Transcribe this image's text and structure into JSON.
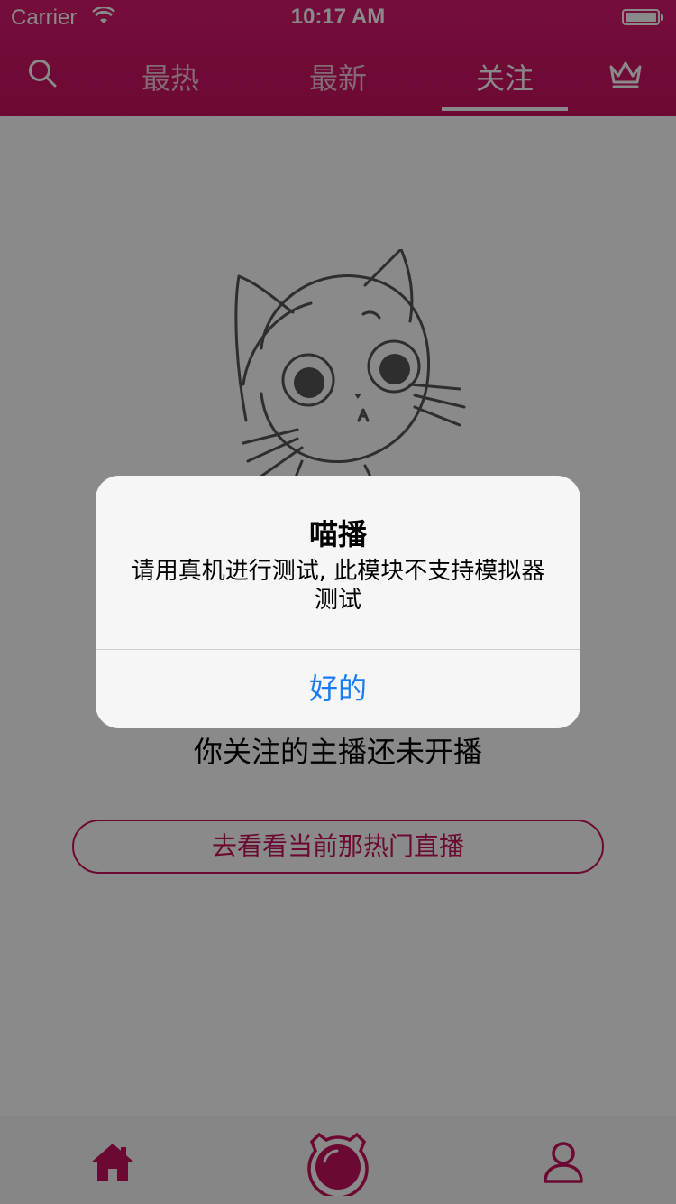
{
  "status_bar": {
    "carrier": "Carrier",
    "time": "10:17 AM"
  },
  "nav": {
    "tabs": [
      {
        "label": "最热"
      },
      {
        "label": "最新"
      },
      {
        "label": "关注"
      }
    ],
    "active_tab": "关注",
    "icons": {
      "search": "search-icon",
      "ranking": "crown-icon"
    }
  },
  "content": {
    "empty_message": "你关注的主播还未开播",
    "go_hot_button": "去看看当前那热门直播",
    "illustration": "cat-illustration"
  },
  "tabbar": {
    "items": [
      {
        "icon": "home-icon"
      },
      {
        "icon": "live-camera-icon"
      },
      {
        "icon": "profile-icon"
      }
    ]
  },
  "alert": {
    "title": "喵播",
    "message": "请用真机进行测试, 此模块不支持模拟器测试",
    "ok_button": "好的"
  },
  "colors": {
    "brand": "#c8125f",
    "alert_button": "#1a7cf5"
  }
}
